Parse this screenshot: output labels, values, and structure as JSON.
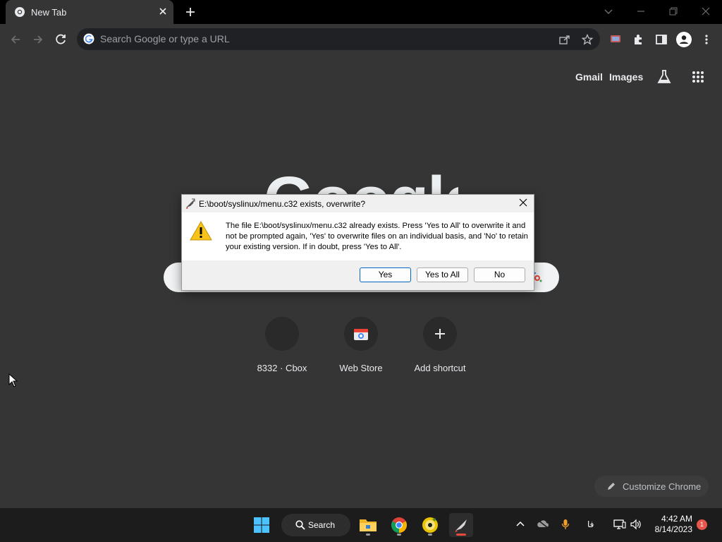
{
  "browser": {
    "tab_title": "New Tab",
    "omnibox_placeholder": "Search Google or type a URL"
  },
  "ntp": {
    "gmail_label": "Gmail",
    "images_label": "Images",
    "logo_text": "Google",
    "shortcuts": [
      {
        "label": "8332 · Cbox"
      },
      {
        "label": "Web Store"
      },
      {
        "label": "Add shortcut"
      }
    ],
    "customize_label": "Customize Chrome"
  },
  "dialog": {
    "title": "E:\\boot/syslinux/menu.c32 exists, overwrite?",
    "message": "The file E:\\boot/syslinux/menu.c32 already exists. Press 'Yes to All' to overwrite it and not be prompted again, 'Yes' to overwrite files on an individual basis, and 'No' to retain your existing version. If in doubt, press 'Yes to All'.",
    "buttons": {
      "yes": "Yes",
      "yes_all": "Yes to All",
      "no": "No"
    }
  },
  "taskbar": {
    "search_label": "Search",
    "time": "4:42 AM",
    "date": "8/14/2023",
    "notification_count": "1",
    "input_lang": "فا"
  },
  "colors": {
    "accent": "#0067c0",
    "background": "#353535",
    "taskbar": "#1c1c1c"
  }
}
